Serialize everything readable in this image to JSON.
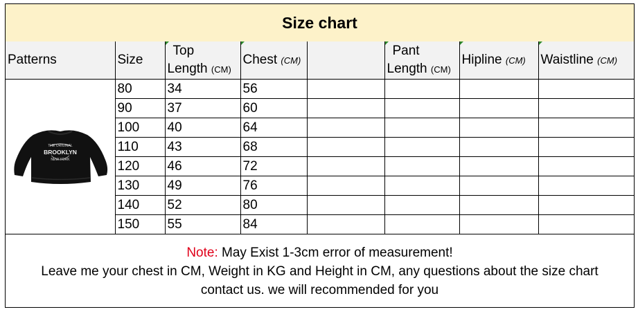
{
  "title": "Size chart",
  "headers": {
    "patterns": "Patterns",
    "size": "Size",
    "top_length_line1": "Top",
    "top_length_line2": "Length",
    "chest": "Chest",
    "pant_length_line1": "Pant",
    "pant_length_line2": "Length",
    "hipline": "Hipline",
    "waistline": "Waistline",
    "unit": "(CM)"
  },
  "rows": [
    {
      "size": "80",
      "top_length": "34",
      "chest": "56"
    },
    {
      "size": "90",
      "top_length": "37",
      "chest": "60"
    },
    {
      "size": "100",
      "top_length": "40",
      "chest": "64"
    },
    {
      "size": "110",
      "top_length": "43",
      "chest": "68"
    },
    {
      "size": "120",
      "top_length": "46",
      "chest": "72"
    },
    {
      "size": "130",
      "top_length": "49",
      "chest": "76"
    },
    {
      "size": "140",
      "top_length": "52",
      "chest": "80"
    },
    {
      "size": "150",
      "top_length": "55",
      "chest": "84"
    }
  ],
  "product_image": {
    "type": "black long-sleeve sweatshirt",
    "print_text": [
      "THE ORIGINAL",
      "BROOKLYN",
      "NEW YORK"
    ]
  },
  "footer": {
    "note_label": "Note:",
    "note_text": " May Exist 1-3cm error of measurement!",
    "line2": "Leave me your chest in CM, Weight in KG and Height in CM, any questions about the size chart",
    "line3": "contact us. we will recommended for you"
  },
  "colors": {
    "title_bg": "#fdf2c9",
    "header_bg": "#f2f2f2",
    "note_red": "#e0001a",
    "cell_marker": "#2e8b2e"
  }
}
